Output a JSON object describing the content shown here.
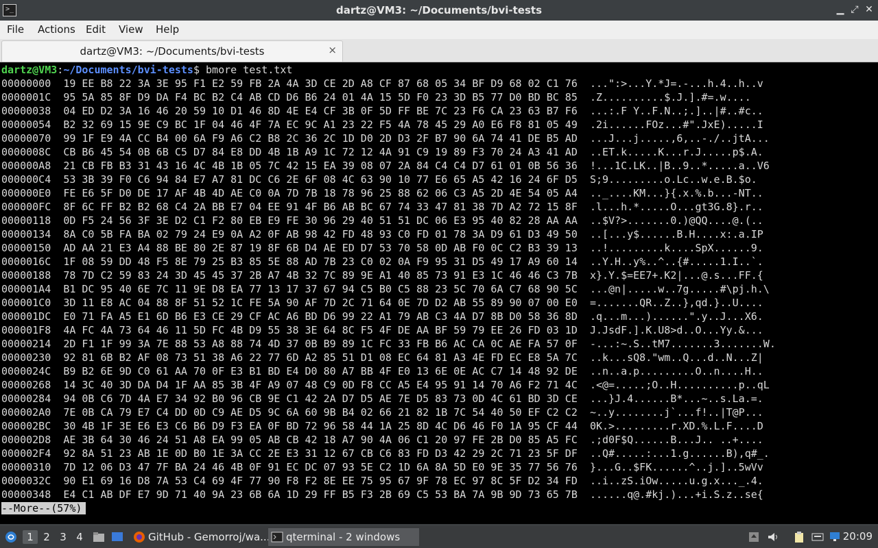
{
  "window": {
    "title": "dartz@VM3: ~/Documents/bvi-tests"
  },
  "menu": {
    "items": [
      "File",
      "Actions",
      "Edit",
      "View",
      "Help"
    ]
  },
  "tab": {
    "label": "dartz@VM3: ~/Documents/bvi-tests",
    "close": "×"
  },
  "prompt": {
    "user": "dartz@VM3",
    "sep": ":",
    "path": "~/Documents/bvi-tests",
    "cmd": "$ bmore test.txt"
  },
  "hexdump": [
    {
      "off": "00000000",
      "hex": "19 EE B8 22 3A 3E 95 F1 E2 59 FB 2A 4A 3D CE 2D A8 CF 87 68 05 34 BF D9 68 02 C1 76",
      "ascii": "...\":>...Y.*J=.-...h.4..h..v"
    },
    {
      "off": "0000001C",
      "hex": "95 5A 85 8F D9 DA F4 BC B2 C4 AB CD D6 B6 24 01 4A 15 5D F0 23 3D B5 77 D0 BD BC 85",
      "ascii": ".Z..........$.J.].#=.w...."
    },
    {
      "off": "00000038",
      "hex": "04 ED D2 3A 16 46 20 59 10 D1 46 8D 4E E4 CF 3B 0F 5D FF BE 7C 23 F6 CA 23 63 B7 F6",
      "ascii": "...:.F Y..F.N..;.]..|#..#c.."
    },
    {
      "off": "00000054",
      "hex": "B2 32 69 15 9E C9 BC 1F 04 46 4F 7A EC 9C A1 23 22 F5 4A 78 45 29 A0 E6 F8 81 05 49",
      "ascii": ".2i......FOz...#\".JxE).....I"
    },
    {
      "off": "00000070",
      "hex": "99 1F E9 4A CC B4 00 6A F9 A6 C2 B8 2C 36 2C 1D D0 2D D3 2F B7 90 6A 74 41 DE B5 AD",
      "ascii": "...J...j.....,6,..-./..jtA..."
    },
    {
      "off": "0000008C",
      "hex": "CB B6 45 54 0B 6B C5 D7 84 E8 DD 4B 1B A9 1C 72 12 4A 91 C9 19 89 F3 70 24 A3 41 AD",
      "ascii": "..ET.k.....K...r.J.....p$.A."
    },
    {
      "off": "000000A8",
      "hex": "21 CB FB B3 31 43 16 4C 4B 1B 05 7C 42 15 EA 39 08 07 2A 84 C4 C4 D7 61 01 0B 56 36",
      "ascii": "!...1C.LK..|B..9..*.....a..V6"
    },
    {
      "off": "000000C4",
      "hex": "53 3B 39 F0 C6 94 84 E7 A7 81 DC C6 2E 6F 08 4C 63 90 10 77 E6 65 A5 42 16 24 6F D5",
      "ascii": "S;9.........o.Lc..w.e.B.$o."
    },
    {
      "off": "000000E0",
      "hex": "FE E6 5F D0 DE 17 AF 4B 4D AE C0 0A 7D 7B 18 78 96 25 88 62 06 C3 A5 2D 4E 54 05 A4",
      "ascii": ".._....KM...}{.x.%.b...-NT.."
    },
    {
      "off": "000000FC",
      "hex": "8F 6C FF B2 B2 68 C4 2A BB E7 04 EE 91 4F B6 AB BC 67 74 33 47 81 38 7D A2 72 15 8F",
      "ascii": ".l...h.*.....O...gt3G.8}.r.."
    },
    {
      "off": "00000118",
      "hex": "0D F5 24 56 3F 3E D2 C1 F2 80 EB E9 FE 30 96 29 40 51 51 DC 06 E3 95 40 82 28 AA AA",
      "ascii": "..$V?>.......0.)@QQ....@.(.."
    },
    {
      "off": "00000134",
      "hex": "8A C0 5B FA BA 02 79 24 E9 0A A2 0F AB 98 42 FD 48 93 C0 FD 01 78 3A D9 61 D3 49 50",
      "ascii": "..[...y$......B.H....x:.a.IP"
    },
    {
      "off": "00000150",
      "hex": "AD AA 21 E3 A4 88 BE 80 2E 87 19 8F 6B D4 AE ED D7 53 70 58 0D AB F0 0C C2 B3 39 13",
      "ascii": "..!.........k....SpX......9."
    },
    {
      "off": "0000016C",
      "hex": "1F 08 59 DD 48 F5 8E 79 25 B3 85 5E 88 AD 7B 23 C0 02 0A F9 95 31 D5 49 17 A9 60 14",
      "ascii": "..Y.H..y%..^..{#.....1.I..`."
    },
    {
      "off": "00000188",
      "hex": "78 7D C2 59 83 24 3D 45 45 37 2B A7 4B 32 7C 89 9E A1 40 85 73 91 E3 1C 46 46 C3 7B",
      "ascii": "x}.Y.$=EE7+.K2|...@.s...FF.{"
    },
    {
      "off": "000001A4",
      "hex": "B1 DC 95 40 6E 7C 11 9E D8 EA 77 13 17 37 67 94 C5 B0 C5 88 23 5C 70 6A C7 68 90 5C",
      "ascii": "...@n|.....w..7g.....#\\pj.h.\\"
    },
    {
      "off": "000001C0",
      "hex": "3D 11 E8 AC 04 88 8F 51 52 1C FE 5A 90 AF 7D 2C 71 64 0E 7D D2 AB 55 89 90 07 00 E0",
      "ascii": "=.......QR..Z..},qd.}..U...."
    },
    {
      "off": "000001DC",
      "hex": "E0 71 FA A5 E1 6D B6 E3 CE 29 CF AC A6 BD D6 99 22 A1 79 AB C3 4A D7 8B D0 58 36 8D",
      "ascii": ".q...m...)......\".y..J...X6."
    },
    {
      "off": "000001F8",
      "hex": "4A FC 4A 73 64 46 11 5D FC 4B D9 55 38 3E 64 8C F5 4F DE AA BF 59 79 EE 26 FD 03 1D",
      "ascii": "J.JsdF.].K.U8>d..O...Yy.&..."
    },
    {
      "off": "00000214",
      "hex": "2D F1 1F 99 3A 7E 88 53 A8 88 74 4D 37 0B B9 89 1C FC 33 FB B6 AC CA 0C AE FA 57 0F",
      "ascii": "-...:~.S..tM7.......3.......W."
    },
    {
      "off": "00000230",
      "hex": "92 81 6B B2 AF 08 73 51 38 A6 22 77 6D A2 85 51 D1 08 EC 64 81 A3 4E FD EC E8 5A 7C",
      "ascii": "..k...sQ8.\"wm..Q...d..N...Z|"
    },
    {
      "off": "0000024C",
      "hex": "B9 B2 6E 9D C0 61 AA 70 0F E3 B1 BD E4 D0 80 A7 BB 4F E0 13 6E 0E AC C7 14 48 92 DE",
      "ascii": "..n..a.p.........O..n....H.."
    },
    {
      "off": "00000268",
      "hex": "14 3C 40 3D DA D4 1F AA 85 3B 4F A9 07 48 C9 0D F8 CC A5 E4 95 91 14 70 A6 F2 71 4C",
      "ascii": ".<@=.....;O..H..........p..qL"
    },
    {
      "off": "00000284",
      "hex": "94 0B C6 7D 4A E7 34 92 B0 96 CB 9E C1 42 2A D7 D5 AE 7E D5 83 73 0D 4C 61 BD 3D CE",
      "ascii": "...}J.4......B*...~..s.La.=."
    },
    {
      "off": "000002A0",
      "hex": "7E 0B CA 79 E7 C4 DD 0D C9 AE D5 9C 6A 60 9B B4 02 66 21 82 1B 7C 54 40 50 EF C2 C2",
      "ascii": "~..y........j`...f!..|T@P..."
    },
    {
      "off": "000002BC",
      "hex": "30 4B 1F 3E E6 E3 C6 B6 D9 F3 EA 0F BD 72 96 58 44 1A 25 8D 4C D6 46 F0 1A 95 CF 44",
      "ascii": "0K.>.........r.XD.%.L.F....D"
    },
    {
      "off": "000002D8",
      "hex": "AE 3B 64 30 46 24 51 A8 EA 99 05 AB CB 42 18 A7 90 4A 06 C1 20 97 FE 2B D0 85 A5 FC",
      "ascii": ".;d0F$Q......B...J.. ..+...."
    },
    {
      "off": "000002F4",
      "hex": "92 8A 51 23 AB 1E 0D B0 1E 3A CC 2E E3 31 12 67 CB C6 83 FD D3 42 29 2C 71 23 5F DF",
      "ascii": "..Q#.....:...1.g......B),q#_."
    },
    {
      "off": "00000310",
      "hex": "7D 12 06 D3 47 7F BA 24 46 4B 0F 91 EC DC 07 93 5E C2 1D 6A 8A 5D E0 9E 35 77 56 76",
      "ascii": "}...G..$FK......^..j.]..5wVv"
    },
    {
      "off": "0000032C",
      "hex": "90 E1 69 16 D8 7A 53 C4 69 4F 77 90 F8 F2 8E EE 75 95 67 9F 78 EC 97 8C 5F D2 34 FD",
      "ascii": "..i..zS.iOw.....u.g.x..._.4."
    },
    {
      "off": "00000348",
      "hex": "E4 C1 AB DF E7 9D 71 40 9A 23 6B 6A 1D 29 FF B5 F3 2B 69 C5 53 BA 7A 9B 9D 73 65 7B",
      "ascii": "......q@.#kj.)...+i.S.z..se{"
    }
  ],
  "pager": {
    "status": "--More--(57%)"
  },
  "taskbar": {
    "workspaces": [
      "1",
      "2",
      "3",
      "4"
    ],
    "tasks": [
      "GitHub - Gemorroj/wa...",
      "qterminal - 2 windows"
    ],
    "clock": "20:09"
  }
}
